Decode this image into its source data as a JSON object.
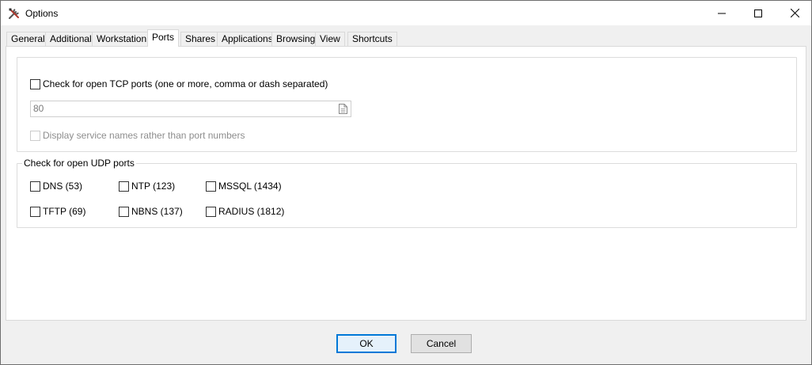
{
  "window": {
    "title": "Options",
    "icon": "tools-icon",
    "controls": [
      "minimize-icon",
      "maximize-icon",
      "close-icon"
    ]
  },
  "tabs": [
    {
      "label": "General",
      "active": false
    },
    {
      "label": "Additional",
      "active": false
    },
    {
      "label": "Workstation",
      "active": false
    },
    {
      "label": "Ports",
      "active": true
    },
    {
      "label": "Shares",
      "active": false
    },
    {
      "label": "Applications",
      "active": false
    },
    {
      "label": "Browsing",
      "active": false
    },
    {
      "label": "View",
      "active": false
    },
    {
      "label": "Shortcuts",
      "active": false
    }
  ],
  "tcp": {
    "check_label": "Check for open TCP ports (one or more, comma or dash separated)",
    "checked": false,
    "ports_value": "80",
    "ports_icon": "file-icon",
    "display_names_label": "Display service names rather than port numbers",
    "display_names_enabled": false
  },
  "udp": {
    "legend": "Check for open UDP ports",
    "ports": [
      {
        "label": "DNS (53)",
        "checked": false
      },
      {
        "label": "NTP (123)",
        "checked": false
      },
      {
        "label": "MSSQL (1434)",
        "checked": false
      },
      {
        "label": "TFTP (69)",
        "checked": false
      },
      {
        "label": "NBNS (137)",
        "checked": false
      },
      {
        "label": "RADIUS (1812)",
        "checked": false
      }
    ]
  },
  "buttons": {
    "ok": "OK",
    "cancel": "Cancel"
  },
  "colors": {
    "accent": "#0078d7",
    "panel_bg": "#ffffff",
    "window_bg": "#f0f0f0"
  }
}
